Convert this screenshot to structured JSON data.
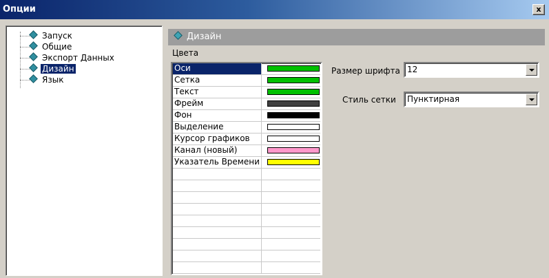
{
  "window": {
    "title": "Опции",
    "close_label": "x"
  },
  "tree": {
    "items": [
      {
        "label": "Запуск"
      },
      {
        "label": "Общие"
      },
      {
        "label": "Экспорт Данных"
      },
      {
        "label": "Дизайн",
        "selected": true
      },
      {
        "label": "Язык"
      }
    ]
  },
  "section": {
    "title": "Дизайн"
  },
  "colors": {
    "label": "Цвета",
    "rows": [
      {
        "name": "Оси",
        "color": "#00c000",
        "selected": true
      },
      {
        "name": "Сетка",
        "color": "#00c000"
      },
      {
        "name": "Текст",
        "color": "#00c000"
      },
      {
        "name": "Фрейм",
        "color": "#404040"
      },
      {
        "name": "Фон",
        "color": "#000000"
      },
      {
        "name": "Выделение",
        "color": "#ffffff"
      },
      {
        "name": "Курсор графиков",
        "color": "#ffffff"
      },
      {
        "name": "Канал (новый)",
        "color": "#ff99cc"
      },
      {
        "name": "Указатель Времени",
        "color": "#ffff00"
      }
    ],
    "empty_rows": 9
  },
  "font_size": {
    "label": "Размер шрифта",
    "value": "12"
  },
  "grid_style": {
    "label": "Стиль сетки",
    "value": "Пунктирная"
  }
}
